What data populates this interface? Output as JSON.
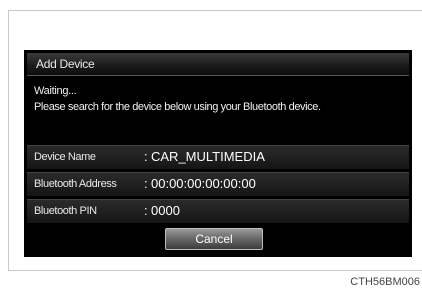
{
  "dialog": {
    "title": "Add Device",
    "status": "Waiting...",
    "instruction": "Please search for the device below using your Bluetooth device.",
    "fields": [
      {
        "label": "Device Name",
        "colon": ":",
        "value": "CAR_MULTIMEDIA"
      },
      {
        "label": "Bluetooth Address",
        "colon": ":",
        "value": "00:00:00:00:00:00"
      },
      {
        "label": "Bluetooth PIN",
        "colon": ":",
        "value": "0000"
      }
    ],
    "cancel_label": "Cancel"
  },
  "figure_code": "CTH56BM006"
}
